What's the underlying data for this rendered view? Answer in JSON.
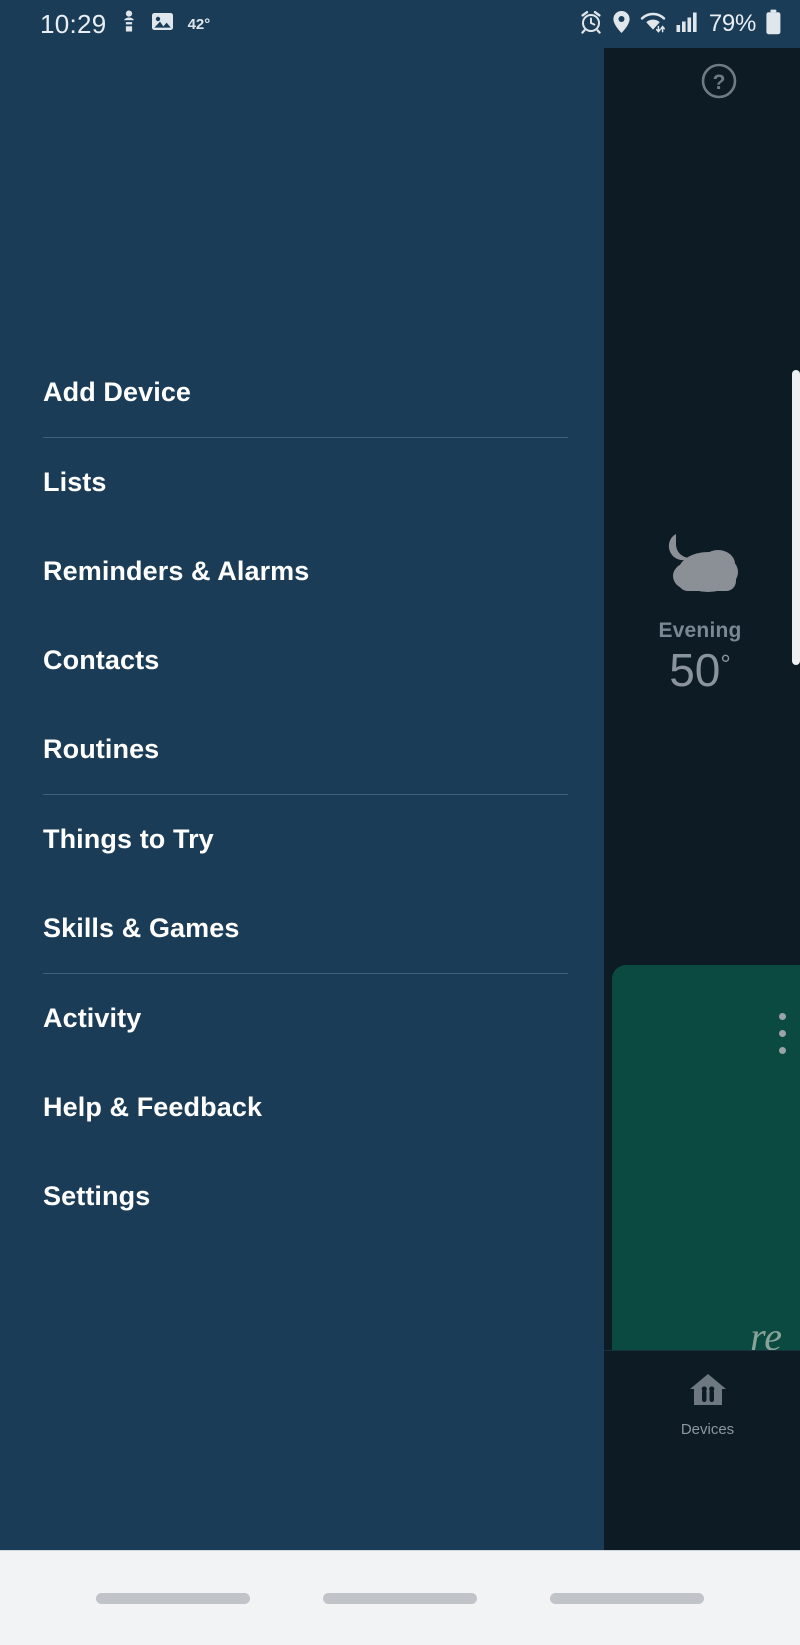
{
  "status_bar": {
    "clock": "10:29",
    "temperature": "42°",
    "battery_percent": "79%",
    "icons": [
      "body-sensor-icon",
      "image-icon",
      "alarm-icon",
      "location-pin-icon",
      "wifi-icon",
      "cellular-signal-icon",
      "battery-icon"
    ]
  },
  "drawer": {
    "items": [
      {
        "label": "Add Device",
        "divider_after": true
      },
      {
        "label": "Lists",
        "divider_after": false
      },
      {
        "label": "Reminders & Alarms",
        "divider_after": false
      },
      {
        "label": "Contacts",
        "divider_after": false
      },
      {
        "label": "Routines",
        "divider_after": true
      },
      {
        "label": "Things to Try",
        "divider_after": false
      },
      {
        "label": "Skills & Games",
        "divider_after": true
      },
      {
        "label": "Activity",
        "divider_after": false
      },
      {
        "label": "Help & Feedback",
        "divider_after": false
      },
      {
        "label": "Settings",
        "divider_after": false
      }
    ]
  },
  "background": {
    "help_icon": "question-mark-circle-icon",
    "weather": {
      "icon": "moon-behind-cloud-icon",
      "period": "Evening",
      "temperature": "50",
      "degree_symbol": "°"
    },
    "card": {
      "overflow_menu": "more-vertical-icon",
      "script_text": "re"
    }
  },
  "bottom_nav": {
    "tabs": [
      {
        "label": "Devices",
        "icon": "devices-home-icon"
      }
    ]
  },
  "colors": {
    "drawer_bg": "#1b3c56",
    "app_bg": "#0d1b24",
    "card_green": "#0b4a40",
    "divider": "#3d6076",
    "text_primary": "#ffffff",
    "text_muted": "#8a949c",
    "gesture_bar": "#f2f3f5"
  }
}
